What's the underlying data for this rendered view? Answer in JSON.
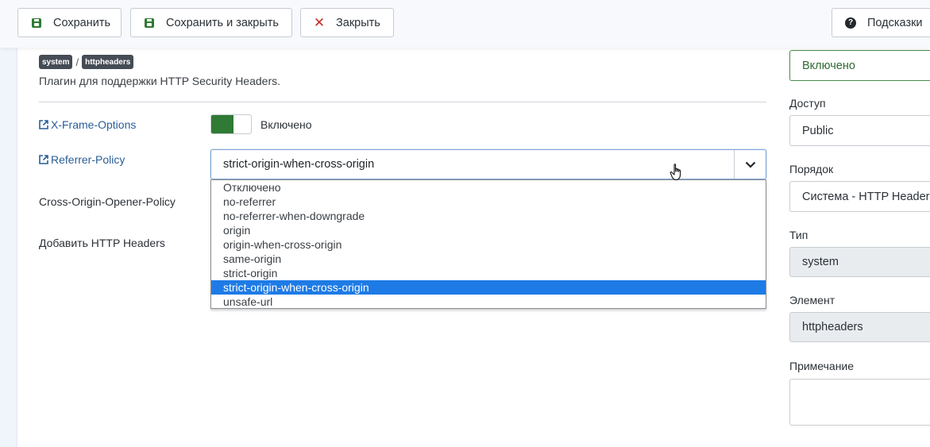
{
  "toolbar": {
    "save_label": "Сохранить",
    "save_close_label": "Сохранить и закрыть",
    "close_label": "Закрыть",
    "help_label": "Подсказки"
  },
  "plugin": {
    "folder_badge": "system",
    "element_badge": "httpheaders",
    "description": "Плагин для поддержки HTTP Security Headers."
  },
  "fields": {
    "xframe": {
      "label": "X-Frame-Options",
      "toggle_text": "Включено",
      "enabled": true
    },
    "referrer": {
      "label": "Referrer-Policy",
      "selected": "strict-origin-when-cross-origin",
      "options": [
        "Отключено",
        "no-referrer",
        "no-referrer-when-downgrade",
        "origin",
        "origin-when-cross-origin",
        "same-origin",
        "strict-origin",
        "strict-origin-when-cross-origin",
        "unsafe-url"
      ],
      "selected_index": 7
    },
    "coop": {
      "label": "Cross-Origin-Opener-Policy"
    },
    "add_headers": {
      "label": "Добавить HTTP Headers"
    }
  },
  "sidebar": {
    "status_value": "Включено",
    "access_label": "Доступ",
    "access_value": "Public",
    "order_label": "Порядок",
    "order_value": "Система - HTTP Headers",
    "type_label": "Тип",
    "type_value": "system",
    "element_label": "Элемент",
    "element_value": "httpheaders",
    "note_label": "Примечание",
    "note_value": ""
  },
  "colors": {
    "accent_green": "#2f7a34",
    "link_blue": "#2a5e98",
    "selected_option": "#1e7be6",
    "close_red": "#c62b2b"
  },
  "icons": {
    "save": "floppy-disk-icon",
    "close": "x-icon",
    "help": "question-circle-icon",
    "external": "external-link-icon",
    "caret": "chevron-down-icon",
    "cursor": "hand-pointer-icon"
  }
}
